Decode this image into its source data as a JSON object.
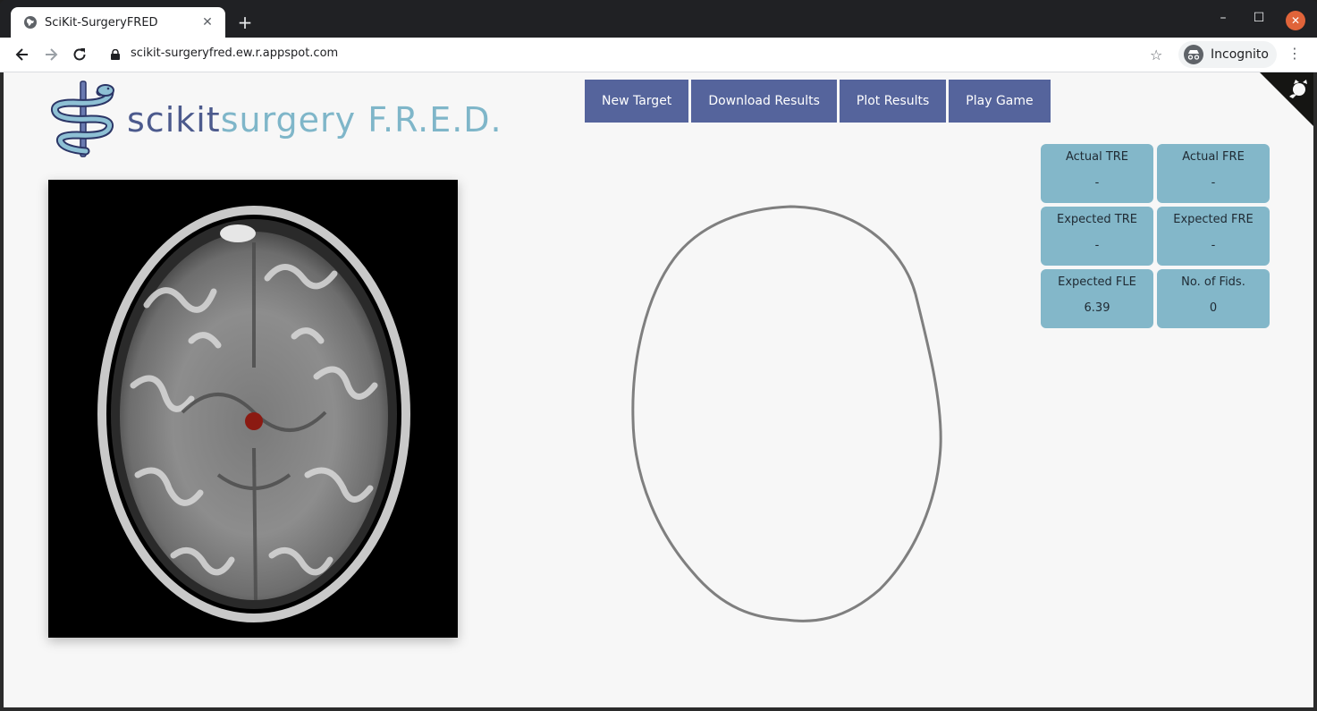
{
  "browser": {
    "tab_title": "SciKit-SurgeryFRED",
    "tab_close": "✕",
    "new_tab": "+",
    "url": "scikit-surgeryfred.ew.r.appspot.com",
    "incognito_label": "Incognito",
    "win_min": "–",
    "win_max": "☐",
    "win_close": "✕",
    "menu": "⋮"
  },
  "logo": {
    "part1": "scikit",
    "part2": "surgery F.R.E.D."
  },
  "buttons": {
    "new_target": "New Target",
    "download_results": "Download Results",
    "plot_results": "Plot Results",
    "play_game": "Play Game"
  },
  "stats": {
    "actual_tre": {
      "label": "Actual TRE",
      "value": "-"
    },
    "actual_fre": {
      "label": "Actual FRE",
      "value": "-"
    },
    "expected_tre": {
      "label": "Expected TRE",
      "value": "-"
    },
    "expected_fre": {
      "label": "Expected FRE",
      "value": "-"
    },
    "expected_fle": {
      "label": "Expected FLE",
      "value": "6.39"
    },
    "no_of_fids": {
      "label": "No. of Fids.",
      "value": "0"
    }
  },
  "colors": {
    "button_bg": "#55649c",
    "stat_bg": "#83b7c9",
    "target_marker": "#8b1a12"
  },
  "icons": {
    "favicon": "globe-icon",
    "back": "arrow-left-icon",
    "forward": "arrow-right-icon",
    "reload": "reload-icon",
    "lock": "lock-icon",
    "star": "star-icon",
    "incognito": "incognito-icon",
    "github_corner": "github-octocat-icon"
  }
}
